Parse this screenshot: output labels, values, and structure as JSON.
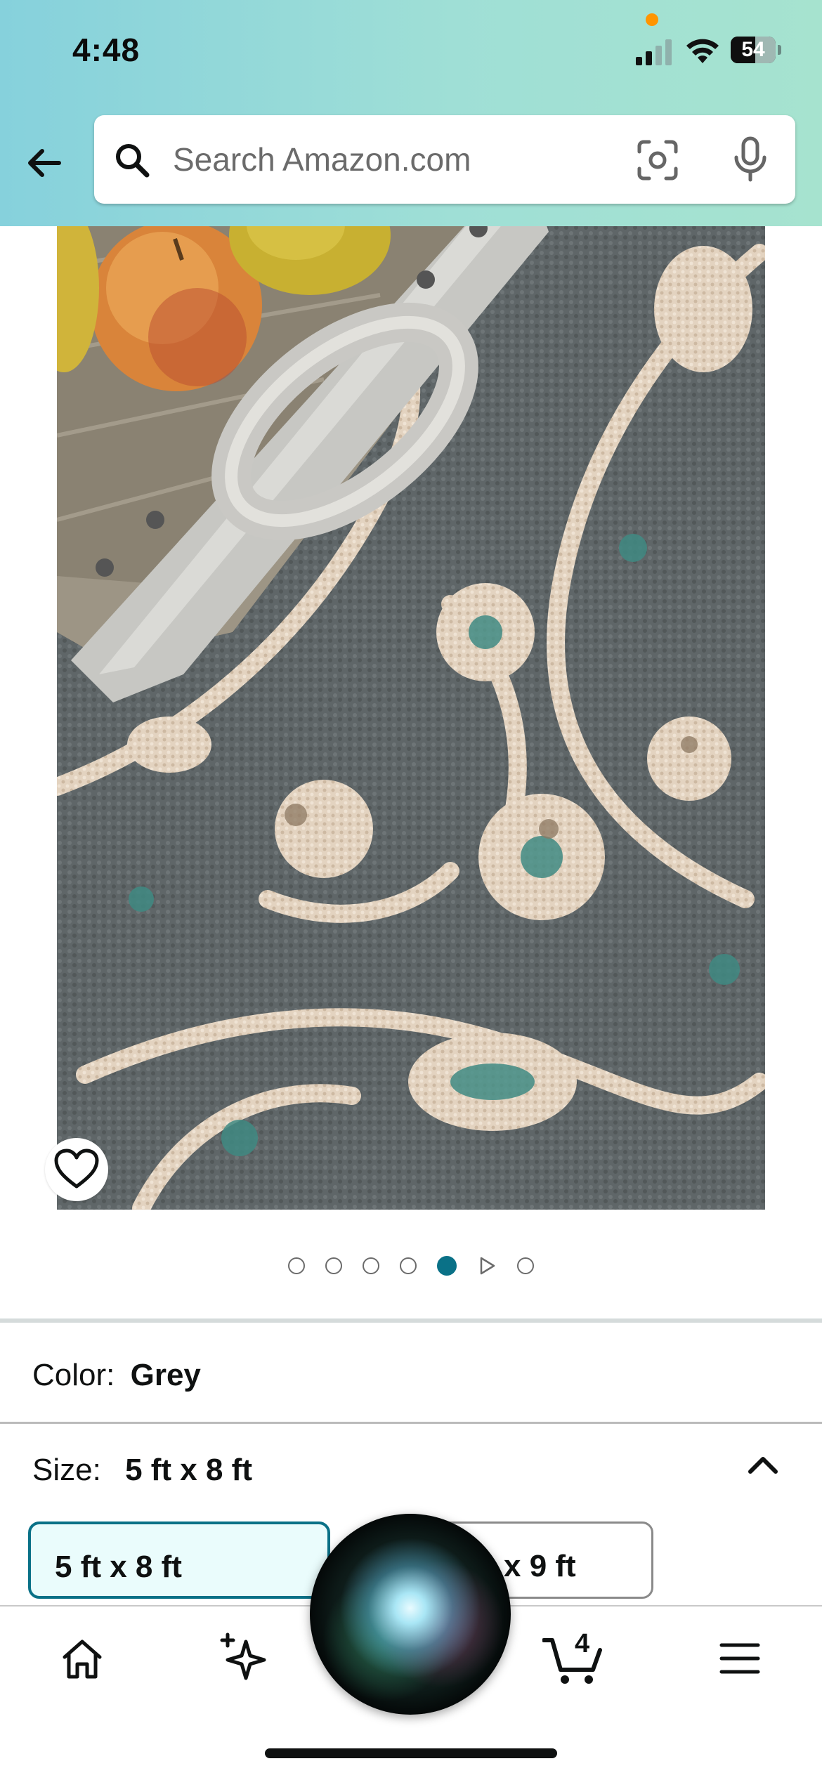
{
  "status_bar": {
    "time": "4:48",
    "battery_level": "54",
    "battery_fraction": 0.54,
    "signal_bars_active": 2,
    "signal_bars_total": 4
  },
  "header": {
    "search": {
      "placeholder": "Search Amazon.com",
      "value": ""
    },
    "icons": [
      "back-arrow-icon",
      "search-icon",
      "camera-lens-icon",
      "microphone-icon"
    ]
  },
  "product_image": {
    "icons": [
      "heart-icon"
    ]
  },
  "carousel": {
    "total_slots": 7,
    "active_index": 4,
    "video_index": 5
  },
  "variations": {
    "color": {
      "label": "Color:",
      "value": "Grey"
    },
    "size": {
      "label": "Size:",
      "value": "5 ft x 8 ft",
      "options": [
        "5 ft x 8 ft",
        "x 9 ft"
      ],
      "selected_index": 0
    }
  },
  "bottom_nav": {
    "items": [
      "home-icon",
      "rufus-sparkle-icon",
      "cart-icon",
      "menu-icon"
    ],
    "cart_count": "4"
  },
  "colors": {
    "accent": "#0a7187",
    "header_gradient_start": "#86d1dc",
    "header_gradient_end": "#a6e3cf",
    "selected_option_bg": "#eafcfc"
  }
}
